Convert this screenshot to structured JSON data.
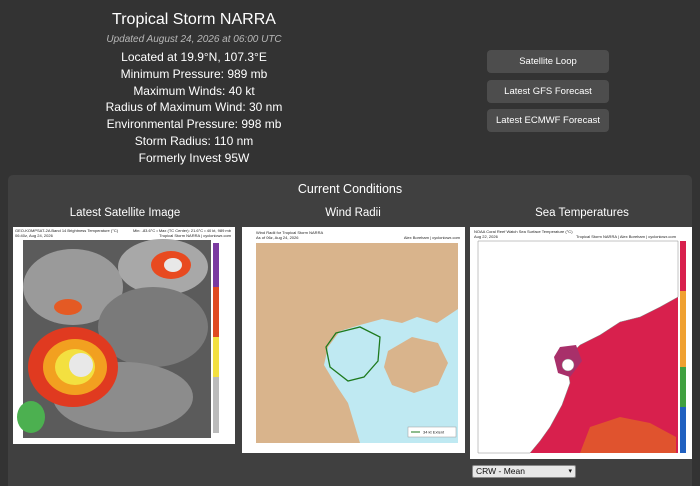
{
  "storm": {
    "title": "Tropical Storm NARRA",
    "updated": "Updated August 24, 2026 at 06:00 UTC",
    "location": "Located at 19.9°N, 107.3°E",
    "min_pressure": "Minimum Pressure: 989 mb",
    "max_winds": "Maximum Winds: 40 kt",
    "rmw": "Radius of Maximum Wind: 30 nm",
    "env_pressure": "Environmental Pressure: 998 mb",
    "storm_radius": "Storm Radius: 110 nm",
    "formerly": "Formerly Invest 95W"
  },
  "buttons": {
    "satellite_loop": "Satellite Loop",
    "gfs": "Latest GFS Forecast",
    "ecmwf": "Latest ECMWF Forecast"
  },
  "conditions": {
    "title": "Current Conditions",
    "satellite": {
      "title": "Latest Satellite Image",
      "caption1": "GEO-KOMPSAT-2A Band 14 Brightness Temperature (°C)",
      "caption2": "06:40z, Aug 24, 2026",
      "caption_right": "Min: -83.6°C • Max (TC Center): 21.6°C • 40 kt, 989 mb",
      "caption_right2": "Tropical Storm NARRA | cyclonicwx.com"
    },
    "wind": {
      "title": "Wind Radii",
      "caption1": "Wind Radii for Tropical Storm NARRA",
      "caption2": "As of 06z, Aug 24, 2026",
      "caption_right": "Alex Boreham | cyclonicwx.com",
      "legend": "34 kt Extent"
    },
    "sst": {
      "title": "Sea Temperatures",
      "caption1": "NOAA Coral Reef Watch Sea Surface Temperature (°C)",
      "caption2": "Aug 22, 2026",
      "caption_right": "Tropical Storm NARRA | Alex Boreham | cyclonicwx.com",
      "select_value": "CRW - Mean"
    }
  },
  "colors": {
    "background": "#333333",
    "panel": "#404040",
    "button": "#4d4d4d",
    "ocean": "#bfe9f2",
    "land": "#d9b48c",
    "wind_outline": "#1e7a1e",
    "sst_warm": "#d8204d"
  }
}
